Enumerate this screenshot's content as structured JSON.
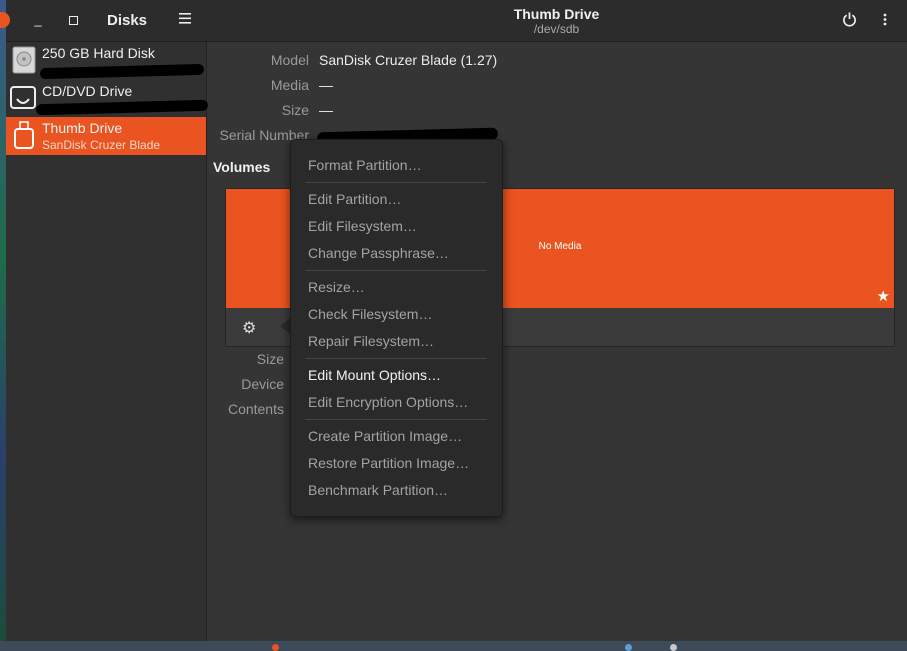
{
  "sidebar": {
    "title": "Disks",
    "devices": [
      {
        "name": "250 GB Hard Disk",
        "sub": "",
        "icon": "hard-disk-icon"
      },
      {
        "name": "CD/DVD Drive",
        "sub": "",
        "icon": "optical-drive-icon"
      },
      {
        "name": "Thumb Drive",
        "sub": "SanDisk Cruzer Blade",
        "icon": "usb-drive-icon"
      }
    ]
  },
  "header": {
    "title": "Thumb Drive",
    "subtitle": "/dev/sdb"
  },
  "details": {
    "model_label": "Model",
    "model_value": "SanDisk Cruzer Blade (1.27)",
    "media_label": "Media",
    "media_value": "—",
    "size_label": "Size",
    "size_value": "—",
    "serial_label": "Serial Number"
  },
  "volumes": {
    "heading": "Volumes",
    "bar_text": "No Media",
    "size_label": "Size",
    "device_label": "Device",
    "contents_label": "Contents"
  },
  "context_menu": {
    "items": [
      "Format Partition…",
      "Edit Partition…",
      "Edit Filesystem…",
      "Change Passphrase…",
      "Resize…",
      "Check Filesystem…",
      "Repair Filesystem…",
      "Edit Mount Options…",
      "Edit Encryption Options…",
      "Create Partition Image…",
      "Restore Partition Image…",
      "Benchmark Partition…"
    ],
    "highlighted": "Edit Mount Options…"
  },
  "colors": {
    "accent": "#e95420",
    "window_bg": "#353535",
    "sidebar_bg": "#303030",
    "menu_bg": "#2a2a2a"
  }
}
